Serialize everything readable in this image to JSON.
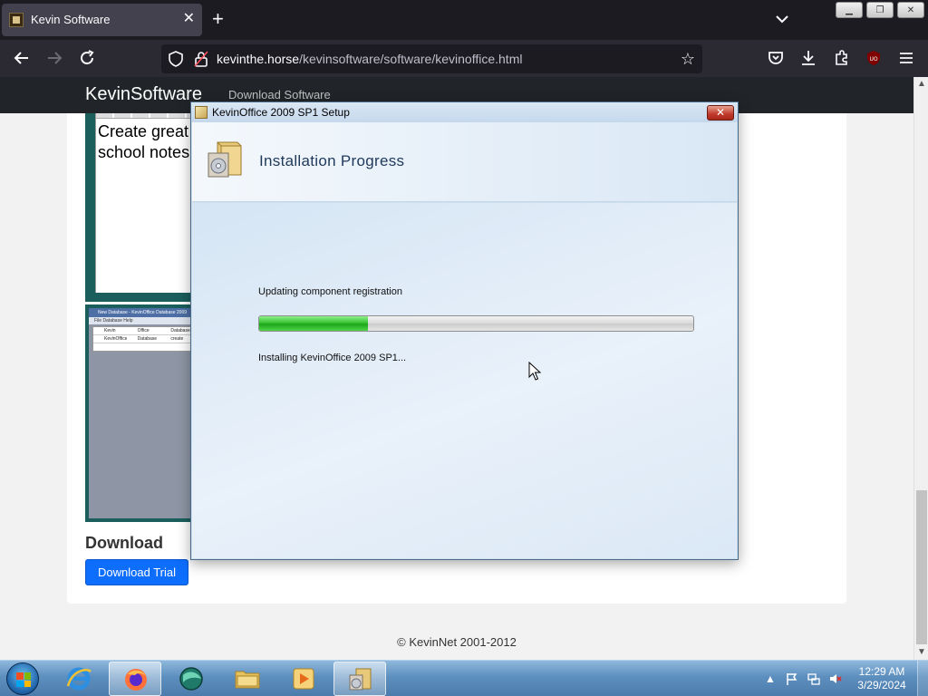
{
  "browser": {
    "tab_title": "Kevin Software",
    "tab_close": "✕",
    "new_tab": "+",
    "url_host": "kevinthe.horse",
    "url_path": "/kevinsoftware/software/kevinoffice.html"
  },
  "site": {
    "brand": "KevinSoftware",
    "nav_link": "Download Software",
    "screenshot1_text": "Create great\nschool notes",
    "screenshot2_title": "New Database - KevinOffice Database 2009",
    "screenshot2_menu": "File   Database   Help",
    "screenshot2_headers": [
      "Kevin",
      "Office",
      "Database"
    ],
    "screenshot2_row": [
      "KevinOffice",
      "Database",
      "create"
    ],
    "download_heading": "Download",
    "download_button": "Download Trial",
    "footer": "© KevinNet 2001-2012"
  },
  "dialog": {
    "title": "KevinOffice 2009 SP1 Setup",
    "close": "✕",
    "header_title": "Installation Progress",
    "status": "Updating component registration",
    "progress_fraction": 0.25,
    "detail": "Installing KevinOffice 2009 SP1..."
  },
  "taskbar": {
    "time": "12:29 AM",
    "date": "3/29/2024"
  },
  "colors": {
    "accent": "#0d6efd",
    "progress_green": "#37c233",
    "browser_dark": "#1c1b22"
  }
}
